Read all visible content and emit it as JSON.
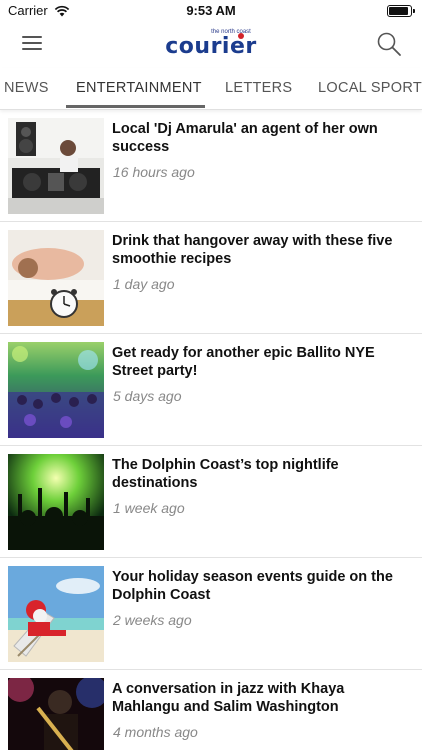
{
  "status_bar": {
    "carrier": "Carrier",
    "time": "9:53 AM",
    "battery_level": 0.9
  },
  "header": {
    "logo_tagline": "the north coast",
    "logo_text": "courier",
    "menu_icon": "hamburger-menu-icon",
    "search_icon": "search-icon"
  },
  "tabs": [
    {
      "label": "NEWS",
      "active": false
    },
    {
      "label": "ENTERTAINMENT",
      "active": true
    },
    {
      "label": "LETTERS",
      "active": false
    },
    {
      "label": "LOCAL SPORT",
      "active": false
    }
  ],
  "articles": [
    {
      "title": "Local 'Dj Amarula' an agent of her own success",
      "time": "16 hours ago",
      "image": "dj-at-decks"
    },
    {
      "title": "Drink that hangover away with these five smoothie recipes",
      "time": "1 day ago",
      "image": "man-asleep-alarm-clock"
    },
    {
      "title": "Get ready for another epic Ballito NYE Street party!",
      "time": "5 days ago",
      "image": "crowd-party-lights"
    },
    {
      "title": "The Dolphin Coast’s top nightlife destinations",
      "time": "1 week ago",
      "image": "concert-crowd-green"
    },
    {
      "title": "Your holiday season events guide on the Dolphin Coast",
      "time": "2 weeks ago",
      "image": "santa-beach-chair"
    },
    {
      "title": "A conversation in jazz with Khaya Mahlangu and Salim Washington",
      "time": "4 months ago",
      "image": "jazz-saxophonist"
    }
  ]
}
